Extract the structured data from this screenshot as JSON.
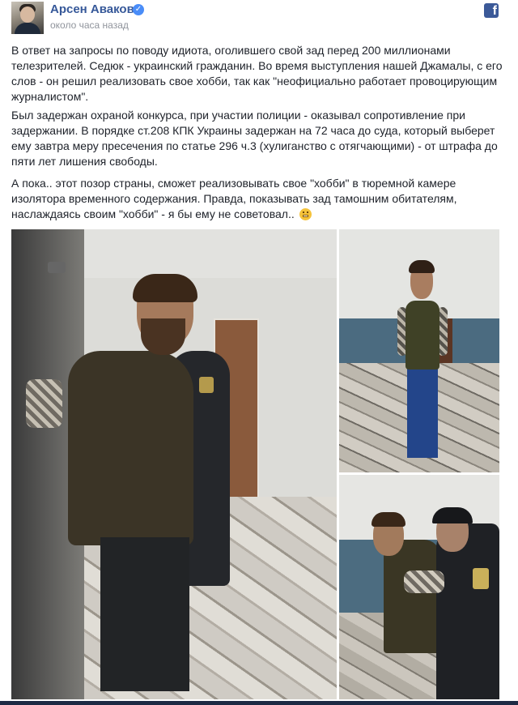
{
  "post": {
    "author": "Арсен Аваков",
    "timestamp": "около часа назад",
    "paragraphs": [
      "В ответ на запросы по поводу идиота, оголившего свой зад перед 200 миллионами телезрителей. Седюк - украинский гражданин. Во время выступления нашей Джамалы, с его слов - он решил реализовать свое хобби, так как \"неофициально работает провоцирующим журналистом\".",
      "Был задержан охраной конкурса, при участии полиции - оказывал сопротивление при задержании. В порядке ст.208 КПК Украины задержан на 72 часа до суда, который выберет ему завтра меру пресечения по статье 296 ч.3 (хулиганство с отягчающими) - от штрафа до пяти лет лишения свободы.",
      "А пока.. этот позор страны, сможет реализовывать свое \"хобби\" в тюремной камере изолятора временного содержания. Правда, показывать зад тамошним обитателям, наслаждаясь своим \"хобби\" - я бы ему не советовал.."
    ]
  },
  "icons": {
    "verified": "verified-badge-icon",
    "facebook": "facebook-icon",
    "emoji": "grimacing-emoji-icon"
  },
  "colors": {
    "author_link": "#365899",
    "timestamp": "#90949c",
    "facebook_brand": "#3b5998",
    "verified": "#4a8df8"
  }
}
